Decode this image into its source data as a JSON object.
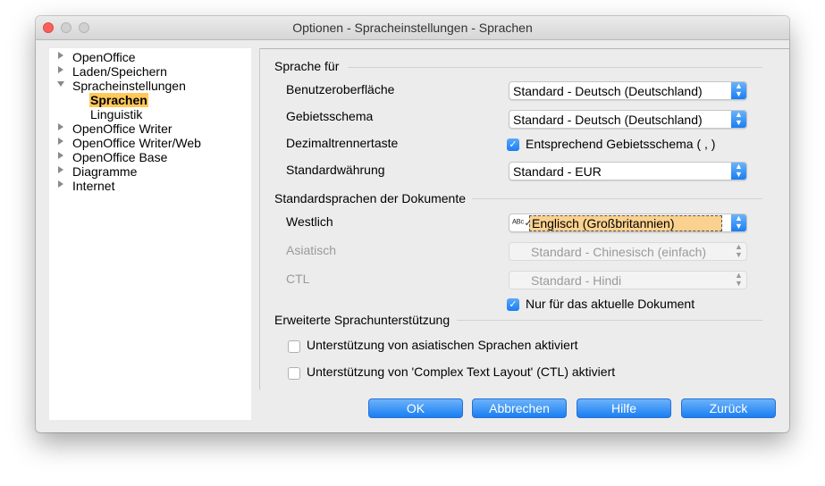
{
  "window": {
    "title": "Optionen - Spracheinstellungen - Sprachen"
  },
  "tree": {
    "items": [
      {
        "label": "OpenOffice"
      },
      {
        "label": "Laden/Speichern"
      },
      {
        "label": "Spracheinstellungen"
      },
      {
        "label": "Sprachen"
      },
      {
        "label": "Linguistik"
      },
      {
        "label": "OpenOffice Writer"
      },
      {
        "label": "OpenOffice Writer/Web"
      },
      {
        "label": "OpenOffice Base"
      },
      {
        "label": "Diagramme"
      },
      {
        "label": "Internet"
      }
    ]
  },
  "sprache_fuer": {
    "heading": "Sprache für",
    "ui_label": "Benutzeroberfläche",
    "ui_value": "Standard - Deutsch (Deutschland)",
    "locale_label": "Gebietsschema",
    "locale_value": "Standard - Deutsch (Deutschland)",
    "decimal_label": "Dezimaltrennertaste",
    "decimal_checkbox": "Entsprechend Gebietsschema ( , )",
    "currency_label": "Standardwährung",
    "currency_value": "Standard - EUR"
  },
  "standardsprachen": {
    "heading": "Standardsprachen der Dokumente",
    "western_label": "Westlich",
    "western_value": "Englisch (Großbritannien)",
    "asian_label": "Asiatisch",
    "asian_value": "Standard - Chinesisch (einfach)",
    "ctl_label": "CTL",
    "ctl_value": "Standard - Hindi",
    "current_doc_checkbox": "Nur für das aktuelle Dokument"
  },
  "erweitert": {
    "heading": "Erweiterte Sprachunterstützung",
    "asian_support": "Unterstützung von asiatischen Sprachen aktiviert",
    "ctl_support": "Unterstützung von 'Complex Text Layout' (CTL) aktiviert"
  },
  "buttons": {
    "ok": "OK",
    "cancel": "Abbrechen",
    "help": "Hilfe",
    "back": "Zurück"
  },
  "colors": {
    "accent": "#1a7ef3",
    "selection": "#ffc85a"
  }
}
